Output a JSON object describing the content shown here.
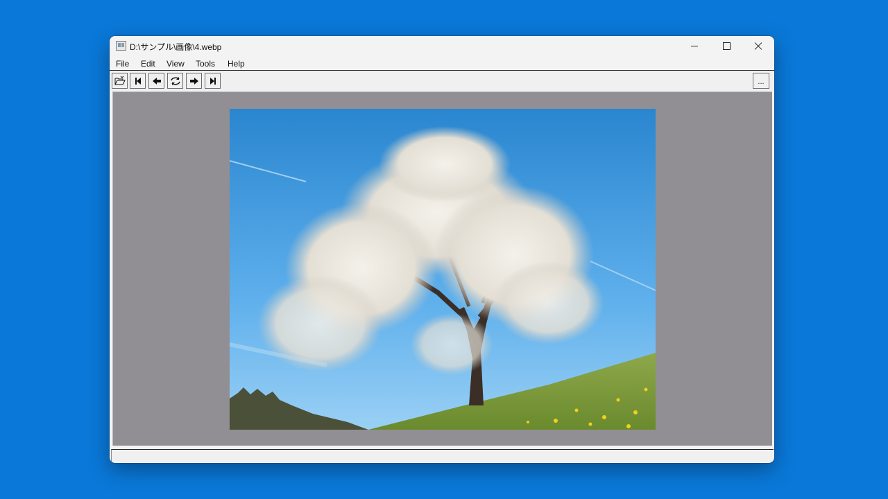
{
  "window": {
    "title": "D:\\サンプル\\画像\\4.webp",
    "icon": "app-icon"
  },
  "menu": {
    "file": "File",
    "edit": "Edit",
    "view": "View",
    "tools": "Tools",
    "help": "Help"
  },
  "toolbar": {
    "buttons": [
      "open-folder-icon",
      "first-image-icon",
      "previous-image-icon",
      "reload-icon",
      "next-image-icon",
      "last-image-icon"
    ],
    "more_label": "..."
  },
  "viewer": {
    "image_subject": "blossoming tree on grassy hill under blue sky"
  },
  "statusbar": {
    "text": ""
  },
  "colors": {
    "desktop": "#0a78d8",
    "viewer_background": "#918f93",
    "window_chrome": "#f3f3f3"
  }
}
